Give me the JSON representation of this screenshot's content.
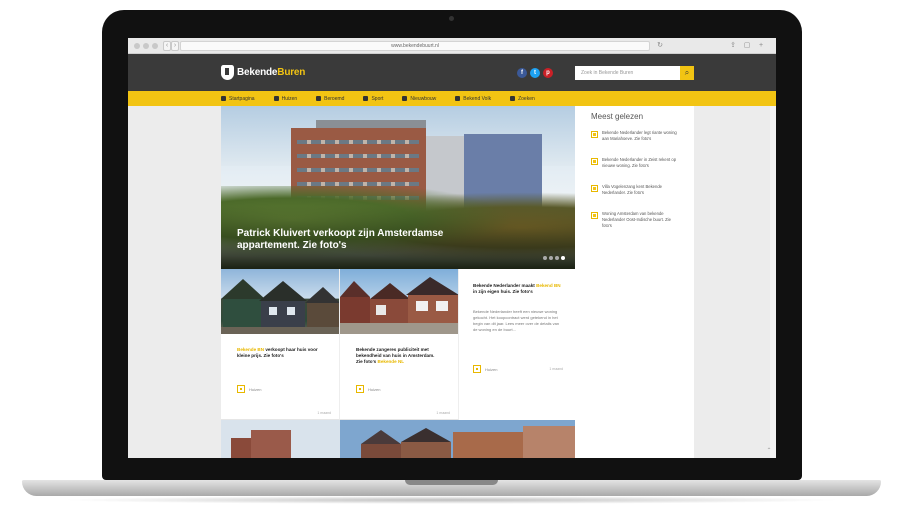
{
  "browser": {
    "url": "www.bekendebuurt.nl",
    "back_icon": "chevron-left-icon",
    "forward_icon": "chevron-right-icon"
  },
  "site": {
    "logo_prefix": "Bekende",
    "logo_suffix": "Buren",
    "search_placeholder": "Zoek in Bekende Buren",
    "accent": "#f2c413"
  },
  "social": [
    {
      "name": "facebook-icon",
      "glyph": "f",
      "color": "#3b5998"
    },
    {
      "name": "twitter-icon",
      "glyph": "t",
      "color": "#1da1f2"
    },
    {
      "name": "pinterest-icon",
      "glyph": "p",
      "color": "#cb2027"
    }
  ],
  "nav": [
    "Startpagina",
    "Huizen",
    "Beroemd",
    "Sport",
    "Nieuwbouw",
    "Bekend Volk",
    "Zoeken"
  ],
  "hero": {
    "title": "Patrick Kluivert verkoopt zijn Amsterdamse appartement. Zie foto's",
    "slides": 4,
    "active": 4
  },
  "sidebar": {
    "title": "Meest gelezen",
    "items": [
      "Bekende Nederlander legt riante woning aan Mariahoeve. Zie foto's",
      "Bekende Nederlander in Zeist rekent op nieuwe woning. Zie foto's",
      "Villa Vogelenzang kent Bekende Nederlander. Zie foto's",
      "Woning Amsterdam van bekende Nederlander Oost-Indische buurt. Zie foto's"
    ]
  },
  "cards": [
    {
      "highlight": "Bekende BN",
      "title": "verkoopt haar huis voor kleine prijs. Zie foto's",
      "meta": "Huizen",
      "date": "1 maand"
    },
    {
      "highlight": "Bekende NL",
      "title": "Bekende zangeres publiciteit met bekendheid van huis in Amsterdam. Zie foto's",
      "meta": "Huizen",
      "date": "1 maand"
    }
  ],
  "text_card": {
    "highlight": "Bekend BN",
    "title_prefix": "Bekende Nederlander maakt",
    "title_suffix": "in zijn eigen huis. Zie foto's",
    "body": "Bekende Nederlander heeft een nieuwe woning gekocht. Het koopcontract werd getekend in het begin van dit jaar. Lees meer over de details van de woning en de buurt...",
    "meta": "Huizen",
    "date": "1 maand"
  },
  "scroll_up_icon": "arrow-up-icon"
}
